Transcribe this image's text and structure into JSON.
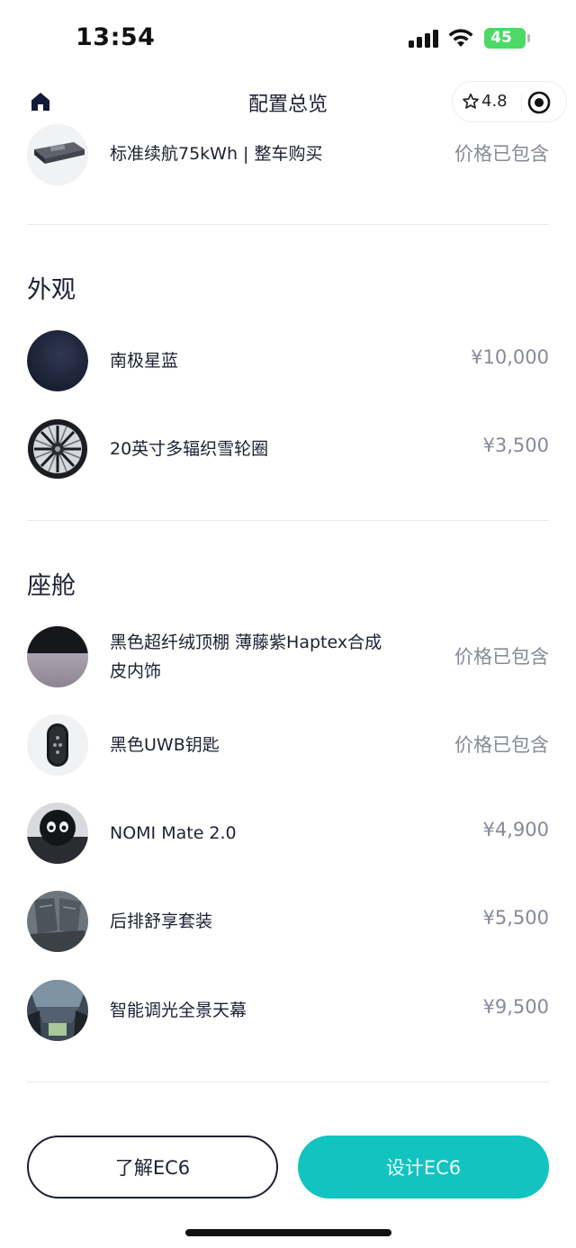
{
  "status_bar": {
    "time": "13:54",
    "battery": "45",
    "battery_color": "#4cd964"
  },
  "nav": {
    "title": "配置总览",
    "rating": "4.8"
  },
  "battery_row": {
    "name": "标准续航75kWh | 整车购买",
    "price": "价格已包含"
  },
  "sections": [
    {
      "title": "外观",
      "items": [
        {
          "name": "南极星蓝",
          "price": "¥10,000"
        },
        {
          "name": "20英寸多辐织雪轮圈",
          "price": "¥3,500"
        }
      ]
    },
    {
      "title": "座舱",
      "items": [
        {
          "name_line1": "黑色超纤绒顶棚 薄藤紫Haptex合成",
          "name_line2": "皮内饰",
          "price": "价格已包含"
        },
        {
          "name": "黑色UWB钥匙",
          "price": "价格已包含"
        },
        {
          "name": "NOMI Mate 2.0",
          "price": "¥4,900"
        },
        {
          "name": "后排舒享套装",
          "price": "¥5,500"
        },
        {
          "name": "智能调光全景天幕",
          "price": "¥9,500"
        }
      ]
    }
  ],
  "buttons": {
    "learn": "了解EC6",
    "design": "设计EC6"
  },
  "colors": {
    "accent": "#12c3c0",
    "text": "#1c2033",
    "muted": "#868a96"
  }
}
